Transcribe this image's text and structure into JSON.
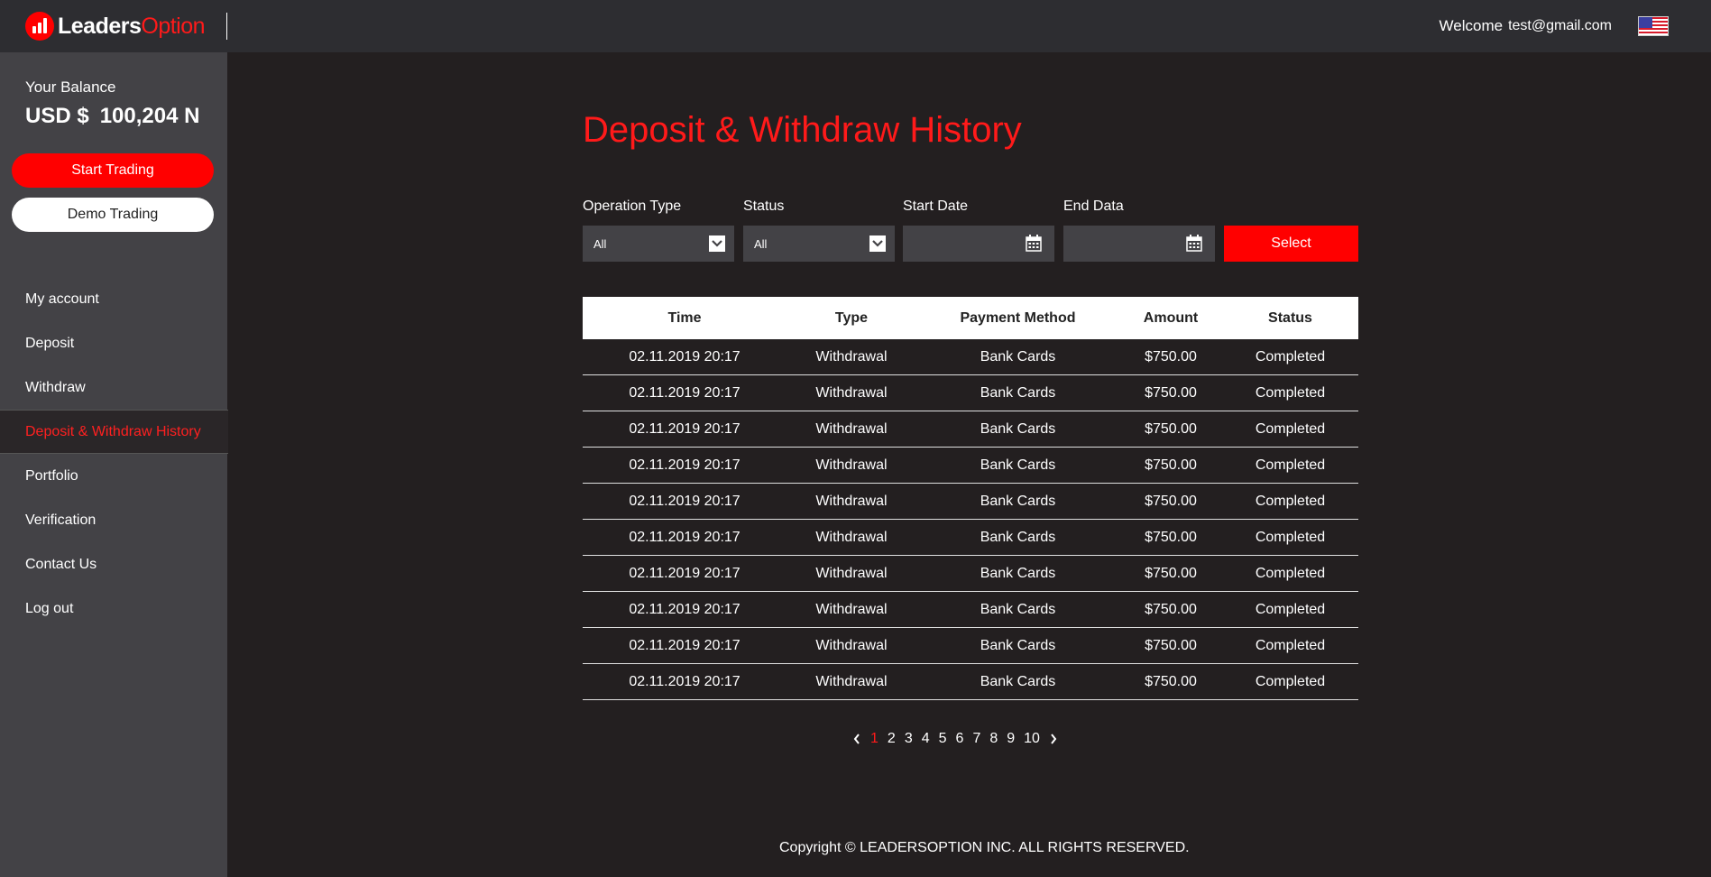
{
  "header": {
    "logo_white": "Leaders",
    "logo_red": "Option",
    "welcome_label": "Welcome",
    "email": "test@gmail.com",
    "flag_icon": "us-flag-icon"
  },
  "sidebar": {
    "balance_label": "Your Balance",
    "currency": "USD $",
    "balance": "100,204 N",
    "start_trading": "Start Trading",
    "demo_trading": "Demo Trading",
    "items": [
      {
        "label": "My account",
        "active": false
      },
      {
        "label": "Deposit",
        "active": false
      },
      {
        "label": "Withdraw",
        "active": false
      },
      {
        "label": "Deposit & Withdraw History",
        "active": true
      },
      {
        "label": "Portfolio",
        "active": false
      },
      {
        "label": "Verification",
        "active": false
      },
      {
        "label": "Contact Us",
        "active": false
      },
      {
        "label": "Log out",
        "active": false
      }
    ]
  },
  "main": {
    "title": "Deposit & Withdraw History",
    "filters": {
      "operation_type_label": "Operation Type",
      "operation_type_value": "All",
      "status_label": "Status",
      "status_value": "All",
      "start_date_label": "Start Date",
      "start_date_value": "",
      "end_date_label": "End Data",
      "end_date_value": "",
      "select_label": "Select"
    },
    "table": {
      "columns": [
        "Time",
        "Type",
        "Payment Method",
        "Amount",
        "Status"
      ],
      "rows": [
        [
          "02.11.2019 20:17",
          "Withdrawal",
          "Bank Cards",
          "$750.00",
          "Completed"
        ],
        [
          "02.11.2019 20:17",
          "Withdrawal",
          "Bank Cards",
          "$750.00",
          "Completed"
        ],
        [
          "02.11.2019 20:17",
          "Withdrawal",
          "Bank Cards",
          "$750.00",
          "Completed"
        ],
        [
          "02.11.2019 20:17",
          "Withdrawal",
          "Bank Cards",
          "$750.00",
          "Completed"
        ],
        [
          "02.11.2019 20:17",
          "Withdrawal",
          "Bank Cards",
          "$750.00",
          "Completed"
        ],
        [
          "02.11.2019 20:17",
          "Withdrawal",
          "Bank Cards",
          "$750.00",
          "Completed"
        ],
        [
          "02.11.2019 20:17",
          "Withdrawal",
          "Bank Cards",
          "$750.00",
          "Completed"
        ],
        [
          "02.11.2019 20:17",
          "Withdrawal",
          "Bank Cards",
          "$750.00",
          "Completed"
        ],
        [
          "02.11.2019 20:17",
          "Withdrawal",
          "Bank Cards",
          "$750.00",
          "Completed"
        ],
        [
          "02.11.2019 20:17",
          "Withdrawal",
          "Bank Cards",
          "$750.00",
          "Completed"
        ]
      ]
    },
    "pagination": {
      "pages": [
        "1",
        "2",
        "3",
        "4",
        "5",
        "6",
        "7",
        "8",
        "9",
        "10"
      ],
      "current": "1"
    }
  },
  "footer": {
    "copyright": "Copyright © LEADERSOPTION INC. ALL RIGHTS RESERVED."
  },
  "colors": {
    "accent": "#ff0000",
    "background": "#231f20",
    "sidebar": "#434246",
    "header": "#2d2d31"
  }
}
